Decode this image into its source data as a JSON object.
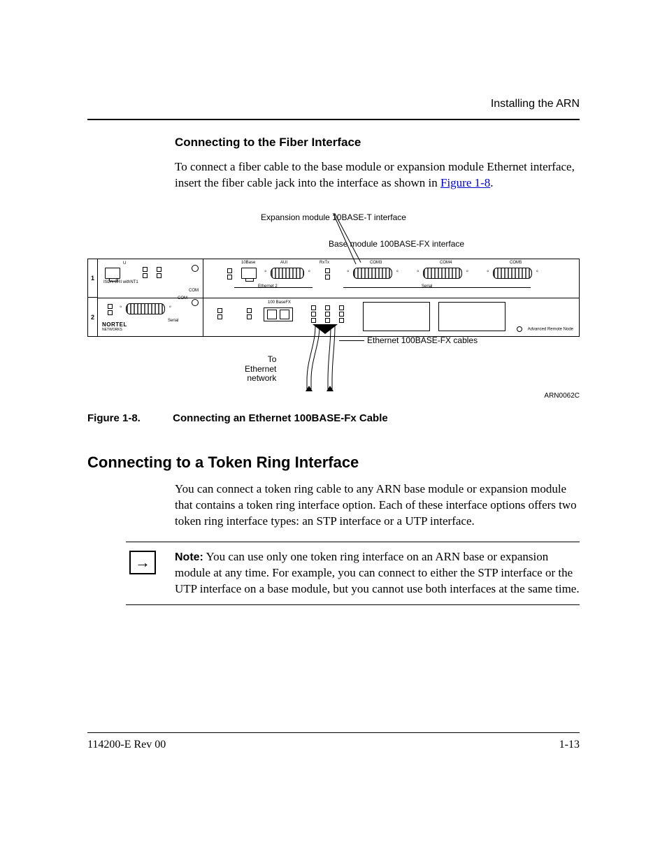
{
  "header": {
    "chapter_title": "Installing the ARN"
  },
  "s1": {
    "heading": "Connecting to the Fiber Interface",
    "para_a": "To connect a fiber cable to the base module or expansion module Ethernet interface, insert the fiber cable jack into the interface as shown in ",
    "link": "Figure 1-8",
    "para_b": "."
  },
  "fig": {
    "callout_expansion": "Expansion module 10BASE-T interface",
    "callout_base": "Base module 100BASE-FX interface",
    "slot1": "1",
    "slot2": "2",
    "lbl_isdn": "ISDN BRI\nwithNT1",
    "lbl_u": "U",
    "lbl_com": "COM",
    "lbl_serial": "Serial",
    "lbl_10base": "10Base",
    "lbl_aui": "AUI",
    "lbl_ethernet2": "Ethernet 2",
    "lbl_rxtx": "RxTx",
    "lbl_com3": "COM3",
    "lbl_com4": "COM4",
    "lbl_com5": "COM5",
    "lbl_100basefx": "100 BaseFX",
    "brand_top": "NORTEL",
    "brand_bot": "NETWORKS",
    "arn": "Advanced Remote Node",
    "to_eth_a": "To",
    "to_eth_b": "Ethernet",
    "to_eth_c": "network",
    "cables": "Ethernet 100BASE-FX cables",
    "code": "ARN0062C",
    "caption_no": "Figure 1-8.",
    "caption_txt": "Connecting an Ethernet 100BASE-Fx Cable"
  },
  "s2": {
    "heading": "Connecting to a Token Ring Interface",
    "para": "You can connect a token ring cable to any ARN base module or expansion module that contains a token ring interface option. Each of these interface options offers two token ring interface types: an STP interface or a UTP interface."
  },
  "note": {
    "label": "Note:",
    "text": " You can use only one token ring interface on an ARN base or expansion module at any time. For example, you can connect to either the STP interface or the UTP interface on a base module, but you cannot use both interfaces at the same time."
  },
  "footer": {
    "doc": "114200-E Rev 00",
    "page": "1-13"
  }
}
